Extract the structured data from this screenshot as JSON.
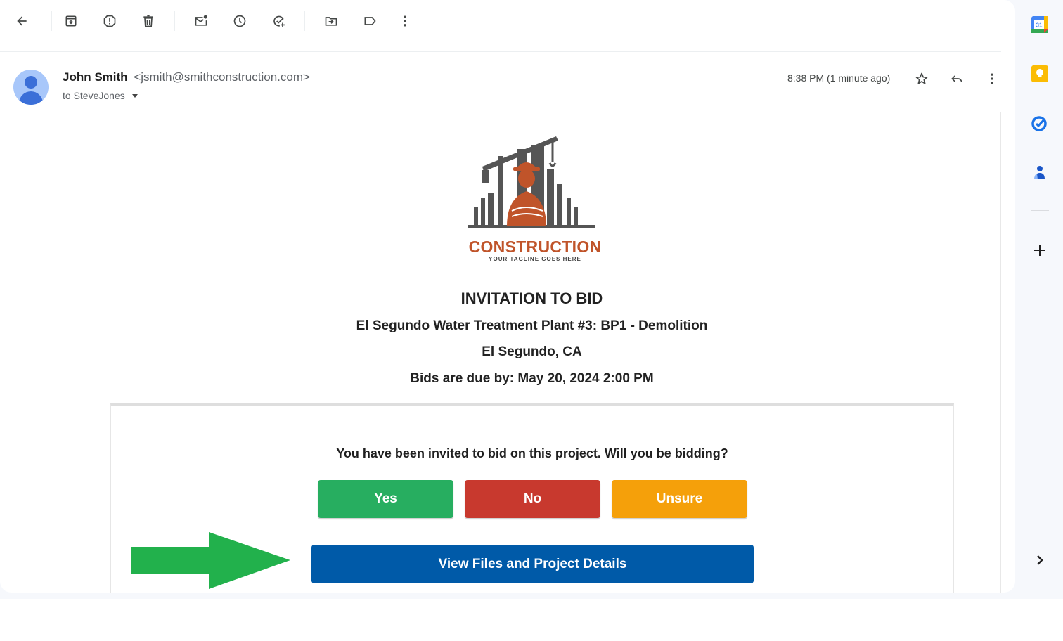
{
  "toolbar": {
    "buttons": [
      {
        "name": "back",
        "label": "Back"
      },
      {
        "name": "archive",
        "label": "Archive"
      },
      {
        "name": "report-spam",
        "label": "Report spam"
      },
      {
        "name": "delete",
        "label": "Delete"
      },
      {
        "name": "mark-unread",
        "label": "Mark as unread"
      },
      {
        "name": "snooze",
        "label": "Snooze"
      },
      {
        "name": "add-to-tasks",
        "label": "Add to Tasks"
      },
      {
        "name": "move-to",
        "label": "Move to"
      },
      {
        "name": "labels",
        "label": "Labels"
      },
      {
        "name": "more",
        "label": "More"
      }
    ]
  },
  "message": {
    "sender_name": "John Smith",
    "sender_email": "<jsmith@smithconstruction.com>",
    "to_line": "to SteveJones",
    "time": "8:38 PM (1 minute ago)"
  },
  "logo": {
    "title": "CONSTRUCTION",
    "tagline": "YOUR TAGLINE GOES HERE",
    "colors": {
      "orange": "#c0542a",
      "gray": "#555555"
    }
  },
  "invitation": {
    "heading": "INVITATION TO BID",
    "project": "El Segundo Water Treatment Plant #3: BP1 - Demolition",
    "location": "El Segundo, CA",
    "due": "Bids are due by: May 20, 2024 2:00 PM",
    "question": "You have been invited to bid on this project. Will you be bidding?",
    "buttons": {
      "yes": "Yes",
      "no": "No",
      "unsure": "Unsure",
      "view": "View Files and Project Details"
    },
    "colors": {
      "yes": "#27ae60",
      "no": "#c8392e",
      "unsure": "#f5a00a",
      "view": "#005aa8",
      "arrow": "#22b14c"
    }
  },
  "side_panel": {
    "apps": [
      {
        "name": "calendar",
        "label": "31"
      },
      {
        "name": "keep",
        "label": "Keep"
      },
      {
        "name": "tasks",
        "label": "Tasks"
      },
      {
        "name": "contacts",
        "label": "Contacts"
      }
    ],
    "add_label": "Get add-ons",
    "expand_label": "Show side panel"
  }
}
